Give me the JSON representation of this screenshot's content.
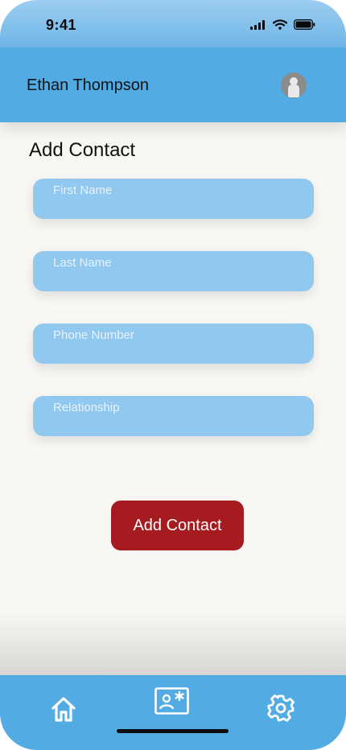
{
  "status_bar": {
    "time": "9:41"
  },
  "header": {
    "user_name": "Ethan Thompson",
    "avatar_icon": "user-avatar-icon"
  },
  "page": {
    "title": "Add Contact"
  },
  "form": {
    "first_name": {
      "placeholder": "First Name",
      "value": ""
    },
    "last_name": {
      "placeholder": "Last Name",
      "value": ""
    },
    "phone_number": {
      "placeholder": "Phone Number",
      "value": ""
    },
    "relationship": {
      "placeholder": "Relationship",
      "value": ""
    },
    "submit_label": "Add Contact"
  },
  "nav": {
    "items": [
      {
        "icon": "home-icon"
      },
      {
        "icon": "contact-card-icon",
        "active": true
      },
      {
        "icon": "gear-icon"
      }
    ]
  },
  "colors": {
    "header": "#52abe3",
    "field": "#91c8ef",
    "button": "#a61b1f",
    "background": "#f8f7f4"
  }
}
